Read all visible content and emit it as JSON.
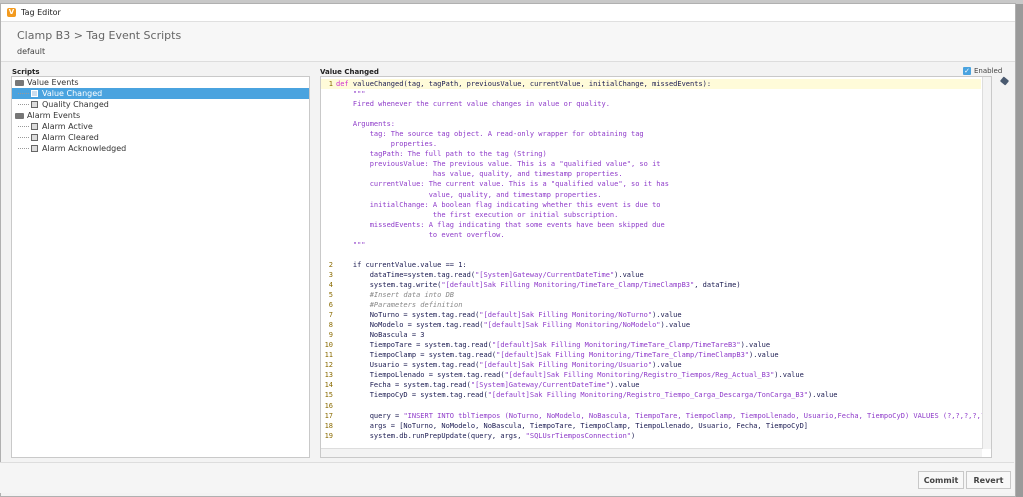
{
  "window": {
    "title": "Tag Editor",
    "app_icon": "ignition-icon"
  },
  "header": {
    "breadcrumb": "Clamp B3 > Tag Event Scripts",
    "provider": "default"
  },
  "scripts_panel": {
    "label": "Scripts",
    "tree": [
      {
        "label": "Value Events",
        "type": "folder"
      },
      {
        "label": "Value Changed",
        "type": "script",
        "selected": true
      },
      {
        "label": "Quality Changed",
        "type": "script"
      },
      {
        "label": "Alarm Events",
        "type": "folder"
      },
      {
        "label": "Alarm Active",
        "type": "script"
      },
      {
        "label": "Alarm Cleared",
        "type": "script"
      },
      {
        "label": "Alarm Acknowledged",
        "type": "script"
      }
    ]
  },
  "editor": {
    "title": "Value Changed",
    "enabled_label": "Enabled",
    "enabled": true,
    "colors": {
      "keyword": "#d12fd1",
      "string": "#8e3ac9",
      "doc": "#8e3ac9",
      "comment": "#888888",
      "text": "#1a1a50"
    },
    "lines": [
      {
        "n": "1",
        "cur": true,
        "s": [
          [
            "k",
            "def"
          ],
          [
            "t",
            " valueChanged(tag, tagPath, previousValue, currentValue, initialChange, missedEvents):"
          ]
        ]
      },
      {
        "n": "",
        "s": [
          [
            "d",
            "    \"\"\""
          ]
        ]
      },
      {
        "n": "",
        "s": [
          [
            "d",
            "    Fired whenever the current value changes in value or quality."
          ]
        ]
      },
      {
        "n": "",
        "s": [
          [
            "d",
            ""
          ]
        ]
      },
      {
        "n": "",
        "s": [
          [
            "d",
            "    Arguments:"
          ]
        ]
      },
      {
        "n": "",
        "s": [
          [
            "d",
            "        tag: The source tag object. A read-only wrapper for obtaining tag"
          ]
        ]
      },
      {
        "n": "",
        "s": [
          [
            "d",
            "             properties."
          ]
        ]
      },
      {
        "n": "",
        "s": [
          [
            "d",
            "        tagPath: The full path to the tag (String)"
          ]
        ]
      },
      {
        "n": "",
        "s": [
          [
            "d",
            "        previousValue: The previous value. This is a \"qualified value\", so it"
          ]
        ]
      },
      {
        "n": "",
        "s": [
          [
            "d",
            "                       has value, quality, and timestamp properties."
          ]
        ]
      },
      {
        "n": "",
        "s": [
          [
            "d",
            "        currentValue: The current value. This is a \"qualified value\", so it has"
          ]
        ]
      },
      {
        "n": "",
        "s": [
          [
            "d",
            "                      value, quality, and timestamp properties."
          ]
        ]
      },
      {
        "n": "",
        "s": [
          [
            "d",
            "        initialChange: A boolean flag indicating whether this event is due to"
          ]
        ]
      },
      {
        "n": "",
        "s": [
          [
            "d",
            "                       the first execution or initial subscription."
          ]
        ]
      },
      {
        "n": "",
        "s": [
          [
            "d",
            "        missedEvents: A flag indicating that some events have been skipped due"
          ]
        ]
      },
      {
        "n": "",
        "s": [
          [
            "d",
            "                      to event overflow."
          ]
        ]
      },
      {
        "n": "",
        "s": [
          [
            "d",
            "    \"\"\""
          ]
        ]
      },
      {
        "n": "",
        "s": [
          [
            "t",
            ""
          ]
        ]
      },
      {
        "n": "2",
        "s": [
          [
            "t",
            "    if currentValue.value == 1:"
          ]
        ]
      },
      {
        "n": "3",
        "s": [
          [
            "t",
            "        dataTime=system.tag.read("
          ],
          [
            "s",
            "\"[System]Gateway/CurrentDateTime\""
          ],
          [
            "t",
            ").value"
          ]
        ]
      },
      {
        "n": "4",
        "s": [
          [
            "t",
            "        system.tag.write("
          ],
          [
            "s",
            "\"[default]Sak Filling Monitoring/TimeTare_Clamp/TimeClampB3\""
          ],
          [
            "t",
            ", dataTime)"
          ]
        ]
      },
      {
        "n": "5",
        "s": [
          [
            "c",
            "        #Insert data into DB"
          ]
        ]
      },
      {
        "n": "6",
        "s": [
          [
            "c",
            "        #Parameters definition"
          ]
        ]
      },
      {
        "n": "7",
        "s": [
          [
            "t",
            "        NoTurno = system.tag.read("
          ],
          [
            "s",
            "\"[default]Sak Filling Monitoring/NoTurno\""
          ],
          [
            "t",
            ").value"
          ]
        ]
      },
      {
        "n": "8",
        "s": [
          [
            "t",
            "        NoModelo = system.tag.read("
          ],
          [
            "s",
            "\"[default]Sak Filling Monitoring/NoModelo\""
          ],
          [
            "t",
            ").value"
          ]
        ]
      },
      {
        "n": "9",
        "s": [
          [
            "t",
            "        NoBascula = 3"
          ]
        ]
      },
      {
        "n": "10",
        "s": [
          [
            "t",
            "        TiempoTare = system.tag.read("
          ],
          [
            "s",
            "\"[default]Sak Filling Monitoring/TimeTare_Clamp/TimeTareB3\""
          ],
          [
            "t",
            ").value"
          ]
        ]
      },
      {
        "n": "11",
        "s": [
          [
            "t",
            "        TiempoClamp = system.tag.read("
          ],
          [
            "s",
            "\"[default]Sak Filling Monitoring/TimeTare_Clamp/TimeClampB3\""
          ],
          [
            "t",
            ").value"
          ]
        ]
      },
      {
        "n": "12",
        "s": [
          [
            "t",
            "        Usuario = system.tag.read("
          ],
          [
            "s",
            "\"[default]Sak Filling Monitoring/Usuario\""
          ],
          [
            "t",
            ").value"
          ]
        ]
      },
      {
        "n": "13",
        "s": [
          [
            "t",
            "        TiempoLlenado = system.tag.read("
          ],
          [
            "s",
            "\"[default]Sak Filling Monitoring/Registro_Tiempos/Reg_Actual_B3\""
          ],
          [
            "t",
            ").value"
          ]
        ]
      },
      {
        "n": "14",
        "s": [
          [
            "t",
            "        Fecha = system.tag.read("
          ],
          [
            "s",
            "\"[System]Gateway/CurrentDateTime\""
          ],
          [
            "t",
            ").value"
          ]
        ]
      },
      {
        "n": "15",
        "s": [
          [
            "t",
            "        TiempoCyD = system.tag.read("
          ],
          [
            "s",
            "\"[default]Sak Filling Monitoring/Registro_Tiempo_Carga_Descarga/TonCarga_B3\""
          ],
          [
            "t",
            ").value"
          ]
        ]
      },
      {
        "n": "16",
        "s": [
          [
            "t",
            ""
          ]
        ]
      },
      {
        "n": "17",
        "s": [
          [
            "t",
            "        query = "
          ],
          [
            "s",
            "\"INSERT INTO tblTiempos (NoTurno, NoModelo, NoBascula, TiempoTare, TiempoClamp, TiempoLlenado, Usuario,Fecha, TiempoCyD) VALUES (?,?,?,?,?,?,?,?,?)\""
          ]
        ]
      },
      {
        "n": "18",
        "s": [
          [
            "t",
            "        args = [NoTurno, NoModelo, NoBascula, TiempoTare, TiempoClamp, TiempoLlenado, Usuario, Fecha, TiempoCyD]"
          ]
        ]
      },
      {
        "n": "19",
        "s": [
          [
            "t",
            "        system.db.runPrepUpdate(query, args, "
          ],
          [
            "s",
            "\"SQLUsrTiemposConnection\""
          ],
          [
            "t",
            ")"
          ]
        ]
      }
    ]
  },
  "footer": {
    "commit_label": "Commit",
    "revert_label": "Revert"
  }
}
